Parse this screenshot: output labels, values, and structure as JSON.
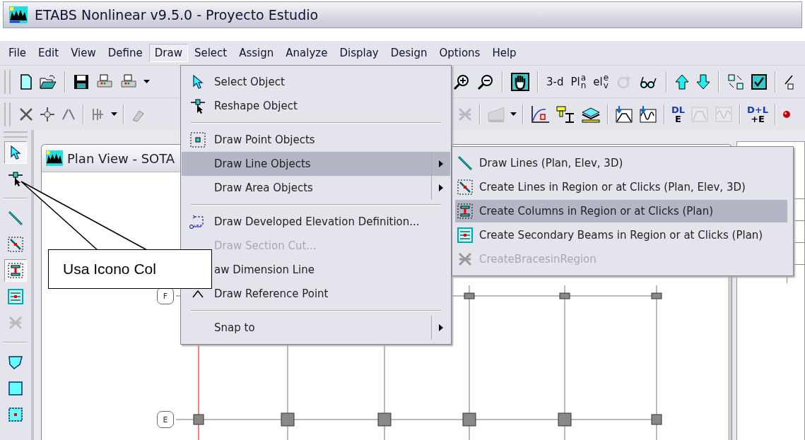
{
  "window": {
    "title": "ETABS Nonlinear v9.5.0 - Proyecto Estudio"
  },
  "menu_bar": [
    {
      "label": "File",
      "selected": false
    },
    {
      "label": "Edit",
      "selected": false
    },
    {
      "label": "View",
      "selected": false
    },
    {
      "label": "Define",
      "selected": false
    },
    {
      "label": "Draw",
      "selected": true
    },
    {
      "label": "Select",
      "selected": false
    },
    {
      "label": "Assign",
      "selected": false
    },
    {
      "label": "Analyze",
      "selected": false
    },
    {
      "label": "Display",
      "selected": false
    },
    {
      "label": "Design",
      "selected": false
    },
    {
      "label": "Options",
      "selected": false
    },
    {
      "label": "Help",
      "selected": false
    }
  ],
  "toolbar_1": [
    {
      "kind": "new"
    },
    {
      "kind": "open"
    },
    {
      "kind": "sep"
    },
    {
      "kind": "save"
    },
    {
      "kind": "print"
    },
    {
      "kind": "print"
    },
    {
      "kind": "dropdown"
    },
    {
      "kind": "gap"
    },
    {
      "kind": "zoom-in"
    },
    {
      "kind": "zoom-out"
    },
    {
      "kind": "sep"
    },
    {
      "kind": "pan"
    },
    {
      "kind": "sep"
    },
    {
      "kind": "text",
      "text": "3-d"
    },
    {
      "kind": "stack",
      "main": "Pl",
      "top": "a",
      "bottom": "n"
    },
    {
      "kind": "stack",
      "main": "el",
      "top": "e",
      "bottom": "v"
    },
    {
      "kind": "rotate",
      "disabled": true
    },
    {
      "kind": "glasses"
    },
    {
      "kind": "sep"
    },
    {
      "kind": "up"
    },
    {
      "kind": "down"
    },
    {
      "kind": "sep"
    },
    {
      "kind": "resize"
    },
    {
      "kind": "check"
    },
    {
      "kind": "sep"
    },
    {
      "kind": "percent"
    }
  ],
  "toolbar_2": [
    {
      "kind": "cross"
    },
    {
      "kind": "move"
    },
    {
      "kind": "mirror"
    },
    {
      "kind": "sep"
    },
    {
      "kind": "replicate"
    },
    {
      "kind": "dropdown"
    },
    {
      "kind": "sep"
    },
    {
      "kind": "paint"
    },
    {
      "kind": "gap"
    },
    {
      "kind": "brace",
      "disabled": true
    },
    {
      "kind": "sep"
    },
    {
      "kind": "building",
      "disabled": true
    },
    {
      "kind": "dropdown"
    },
    {
      "kind": "sep"
    },
    {
      "kind": "curve"
    },
    {
      "kind": "section"
    },
    {
      "kind": "layer"
    },
    {
      "kind": "sep"
    },
    {
      "kind": "load-diagram"
    },
    {
      "kind": "load-wave"
    },
    {
      "kind": "sep"
    },
    {
      "kind": "letters",
      "top": "DL",
      "bottom": "E",
      "disabled": false
    },
    {
      "kind": "frame",
      "disabled": true
    },
    {
      "kind": "wave",
      "disabled": true
    },
    {
      "kind": "sep"
    },
    {
      "kind": "letters",
      "top": "D+L",
      "bottom": "+E",
      "disabled": false
    },
    {
      "kind": "sep"
    },
    {
      "kind": "ball"
    }
  ],
  "side_toolbar": [
    {
      "kind": "pointer",
      "selected": true
    },
    {
      "kind": "reshape",
      "selected": false
    },
    {
      "kind": "sep"
    },
    {
      "kind": "line",
      "selected": false
    },
    {
      "kind": "region-line",
      "selected": false
    },
    {
      "kind": "column",
      "selected": true
    },
    {
      "kind": "beam",
      "selected": false
    },
    {
      "kind": "brace",
      "selected": false,
      "disabled": true
    },
    {
      "kind": "sep"
    },
    {
      "kind": "area",
      "selected": false
    },
    {
      "kind": "rect-area",
      "selected": false
    },
    {
      "kind": "cut-area",
      "selected": false
    }
  ],
  "plan_window": {
    "title": "Plan View - SOTA",
    "grid_labels": [
      "F",
      "E"
    ]
  },
  "draw_menu": [
    {
      "kind": "item",
      "label": "Select Object",
      "disabled": false,
      "submenu": false,
      "selected": false
    },
    {
      "kind": "item",
      "label": "Reshape Object",
      "disabled": false,
      "submenu": false,
      "selected": false
    },
    {
      "kind": "sep"
    },
    {
      "kind": "item",
      "label": "Draw Point Objects",
      "disabled": false,
      "submenu": false,
      "selected": false
    },
    {
      "kind": "item",
      "label": "Draw Line Objects",
      "disabled": false,
      "submenu": true,
      "selected": true
    },
    {
      "kind": "item",
      "label": "Draw Area Objects",
      "disabled": false,
      "submenu": true,
      "selected": false
    },
    {
      "kind": "sep"
    },
    {
      "kind": "item",
      "label": "Draw Developed  Elevation Definition...",
      "disabled": false,
      "submenu": false,
      "selected": false
    },
    {
      "kind": "item",
      "label": "Draw Section Cut...",
      "disabled": true,
      "submenu": false,
      "selected": false
    },
    {
      "kind": "item",
      "label": "aw Dimension Line",
      "disabled": false,
      "submenu": false,
      "selected": false
    },
    {
      "kind": "item",
      "label": "Draw Reference Point",
      "disabled": false,
      "submenu": false,
      "selected": false
    },
    {
      "kind": "sep"
    },
    {
      "kind": "item",
      "label": "Snap to",
      "disabled": false,
      "submenu": true,
      "selected": false
    }
  ],
  "line_submenu": [
    {
      "label": "Draw Lines (Plan, Elev, 3D)",
      "disabled": false,
      "selected": false
    },
    {
      "label": "Create Lines in Region or at Clicks (Plan, Elev, 3D)",
      "disabled": false,
      "selected": false
    },
    {
      "label": "Create Columns in Region or at Clicks (Plan)",
      "disabled": false,
      "selected": true
    },
    {
      "label": "Create Secondary Beams in Region or at Clicks (Plan)",
      "disabled": false,
      "selected": false
    },
    {
      "label": "CreateBracesinRegion",
      "disabled": true,
      "selected": false
    }
  ],
  "callout": {
    "text": "Usa Icono Col"
  }
}
